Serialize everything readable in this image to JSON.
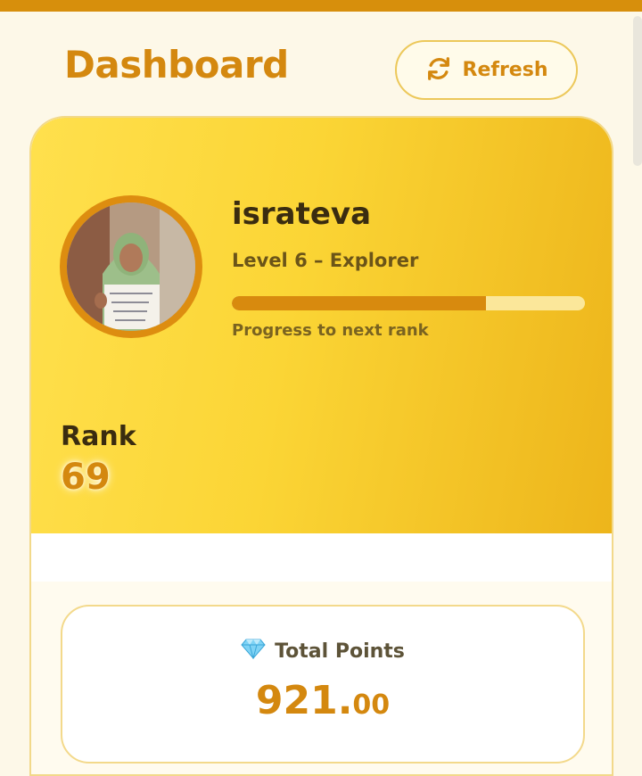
{
  "header": {
    "title": "Dashboard",
    "refresh_label": "Refresh"
  },
  "profile": {
    "username": "israteva",
    "level": "Level 6 – Explorer",
    "progress_fraction": 0.72,
    "progress_caption": "Progress to next rank",
    "avatar_alt": "profile photo"
  },
  "rank": {
    "label": "Rank",
    "value": "69"
  },
  "points": {
    "icon": "diamond-icon",
    "title": "Total Points",
    "value_int": "921.",
    "value_dec": "00"
  },
  "colors": {
    "accent": "#d4880f",
    "hero_start": "#ffe04d",
    "hero_end": "#edb51b",
    "topbar": "#d78f0c"
  }
}
